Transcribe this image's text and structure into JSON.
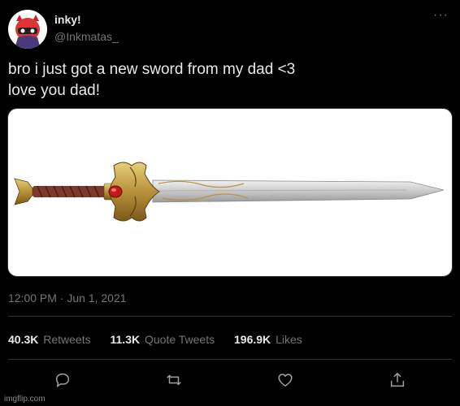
{
  "user": {
    "display_name": "inky!",
    "handle": "@Inkmatas_",
    "avatar_icon": "cartoon-avatar"
  },
  "menu": {
    "more_label": "···",
    "icon": "more-horizontal-icon"
  },
  "tweet": {
    "lines": [
      "bro i just got a new sword from my dad <3",
      "love you dad!"
    ],
    "media_icon": "sword-image",
    "timestamp": "12:00 PM · Jun 1, 2021"
  },
  "stats": [
    {
      "count": "40.3K",
      "label": "Retweets"
    },
    {
      "count": "11.3K",
      "label": "Quote Tweets"
    },
    {
      "count": "196.9K",
      "label": "Likes"
    }
  ],
  "actions": [
    {
      "name": "reply",
      "icon": "reply-icon"
    },
    {
      "name": "retweet",
      "icon": "retweet-icon"
    },
    {
      "name": "like",
      "icon": "heart-icon"
    },
    {
      "name": "share",
      "icon": "share-icon"
    }
  ],
  "watermark": "imgflip.com",
  "colors": {
    "background": "#000000",
    "text": "#e7e9ea",
    "secondary_text": "#71767b",
    "divider": "#2f3336"
  }
}
